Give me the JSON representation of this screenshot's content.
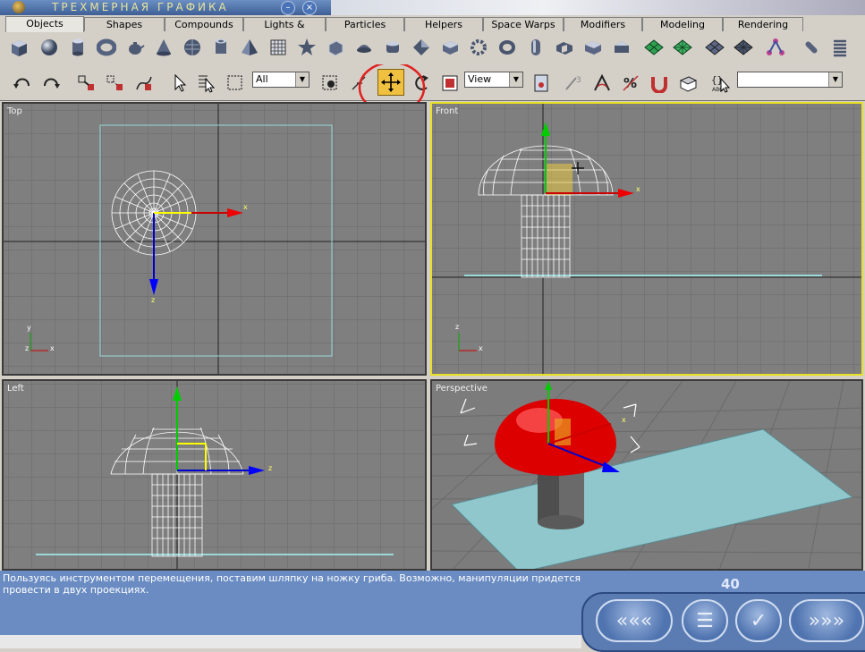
{
  "window": {
    "title": "ТРЕХМЕРНАЯ ГРАФИКА",
    "min_label": "–",
    "close_label": "×"
  },
  "tabs": [
    "Objects",
    "Shapes",
    "Compounds",
    "Lights & Cameras",
    "Particles",
    "Helpers",
    "Space Warps",
    "Modifiers",
    "Modeling",
    "Rendering"
  ],
  "main_toolbar": {
    "selection_filter": "All",
    "coord_system": "View",
    "named_selection": ""
  },
  "viewports": {
    "top": "Top",
    "front": "Front",
    "left": "Left",
    "perspective": "Perspective"
  },
  "axes": {
    "x": "x",
    "y": "y",
    "z": "z"
  },
  "status": {
    "message": "Пользуясь инструментом перемещения, поставим шляпку на ножку гриба. Возможно, манипуляции придется провести в двух проекциях.",
    "page_number": "40"
  },
  "nav": {
    "prev": "«««",
    "menu": "☰",
    "check": "✓",
    "next": "»»»"
  },
  "colors": {
    "selection_highlight": "#e8e020",
    "mushroom_cap": "#dd0000",
    "move_tool_highlight": "#f0c040",
    "annotation_circle": "#e02020"
  }
}
